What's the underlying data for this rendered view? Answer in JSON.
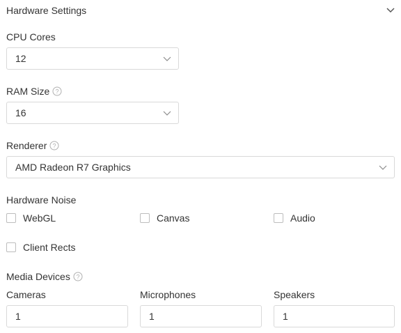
{
  "header": {
    "title": "Hardware Settings",
    "collapse_icon": "chevron-down-icon"
  },
  "cpu": {
    "label": "CPU Cores",
    "value": "12"
  },
  "ram": {
    "label": "RAM Size",
    "value": "16"
  },
  "renderer": {
    "label": "Renderer",
    "value": "AMD Radeon R7 Graphics"
  },
  "noise": {
    "label": "Hardware Noise",
    "options": [
      {
        "label": "WebGL",
        "checked": false
      },
      {
        "label": "Canvas",
        "checked": false
      },
      {
        "label": "Audio",
        "checked": false
      },
      {
        "label": "Client Rects",
        "checked": false
      }
    ]
  },
  "media": {
    "title": "Media Devices",
    "cameras": {
      "label": "Cameras",
      "value": "1"
    },
    "microphones": {
      "label": "Microphones",
      "value": "1"
    },
    "speakers": {
      "label": "Speakers",
      "value": "1"
    }
  },
  "colors": {
    "text": "#333333",
    "border": "#d9d9d9",
    "icon": "#8c8c8c"
  }
}
